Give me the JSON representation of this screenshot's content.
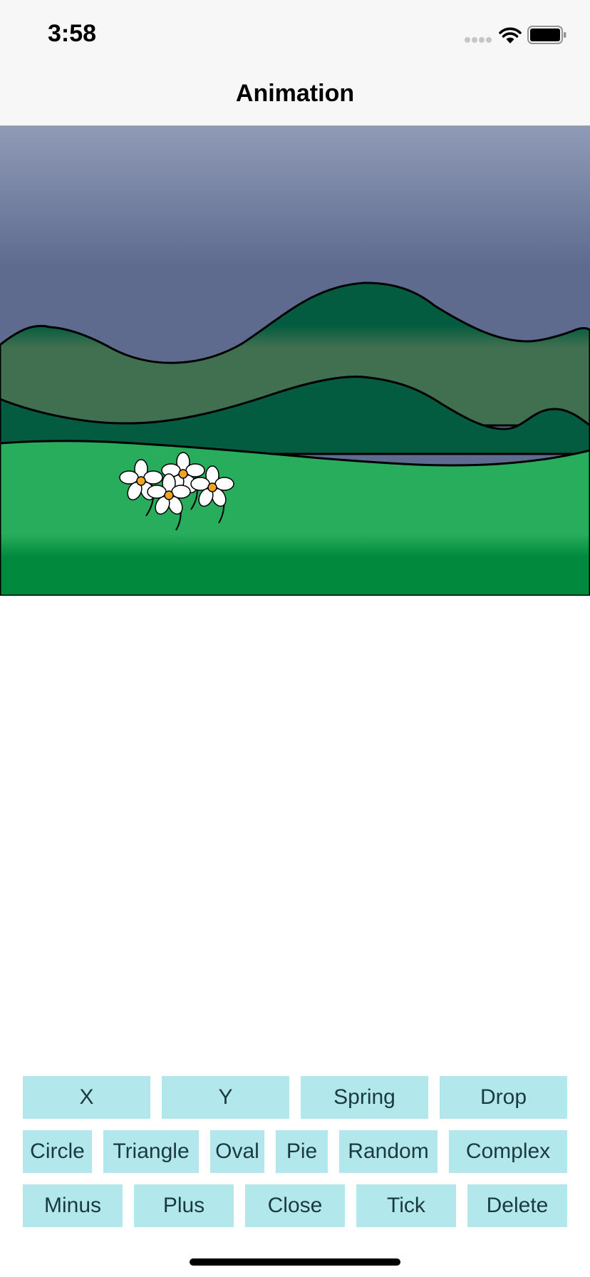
{
  "status_bar": {
    "time": "3:58",
    "icons": [
      "cellular-signal-icon",
      "wifi-icon",
      "battery-icon"
    ]
  },
  "nav": {
    "title": "Animation"
  },
  "scene": {
    "description_icons": [
      "mountains",
      "grass-field",
      "daisy-flowers"
    ],
    "colors": {
      "sky_top": "#8f9bb6",
      "sky_bottom": "#5e6b8f",
      "far_hill": "#40704f",
      "near_hill": "#045c40",
      "grass_top": "#28ad5c",
      "grass_bottom": "#018a3d",
      "flower_center": "#f3a324"
    }
  },
  "buttons": {
    "row1": [
      {
        "id": "x",
        "label": "X"
      },
      {
        "id": "y",
        "label": "Y"
      },
      {
        "id": "spring",
        "label": "Spring"
      },
      {
        "id": "drop",
        "label": "Drop"
      }
    ],
    "row2": [
      {
        "id": "circle",
        "label": "Circle"
      },
      {
        "id": "triangle",
        "label": "Triangle"
      },
      {
        "id": "oval",
        "label": "Oval"
      },
      {
        "id": "pie",
        "label": "Pie"
      },
      {
        "id": "random",
        "label": "Random"
      },
      {
        "id": "complex",
        "label": "Complex"
      }
    ],
    "row3": [
      {
        "id": "minus",
        "label": "Minus"
      },
      {
        "id": "plus",
        "label": "Plus"
      },
      {
        "id": "close",
        "label": "Close"
      },
      {
        "id": "tick",
        "label": "Tick"
      },
      {
        "id": "delete",
        "label": "Delete"
      }
    ],
    "color": "#b2e8ec"
  }
}
